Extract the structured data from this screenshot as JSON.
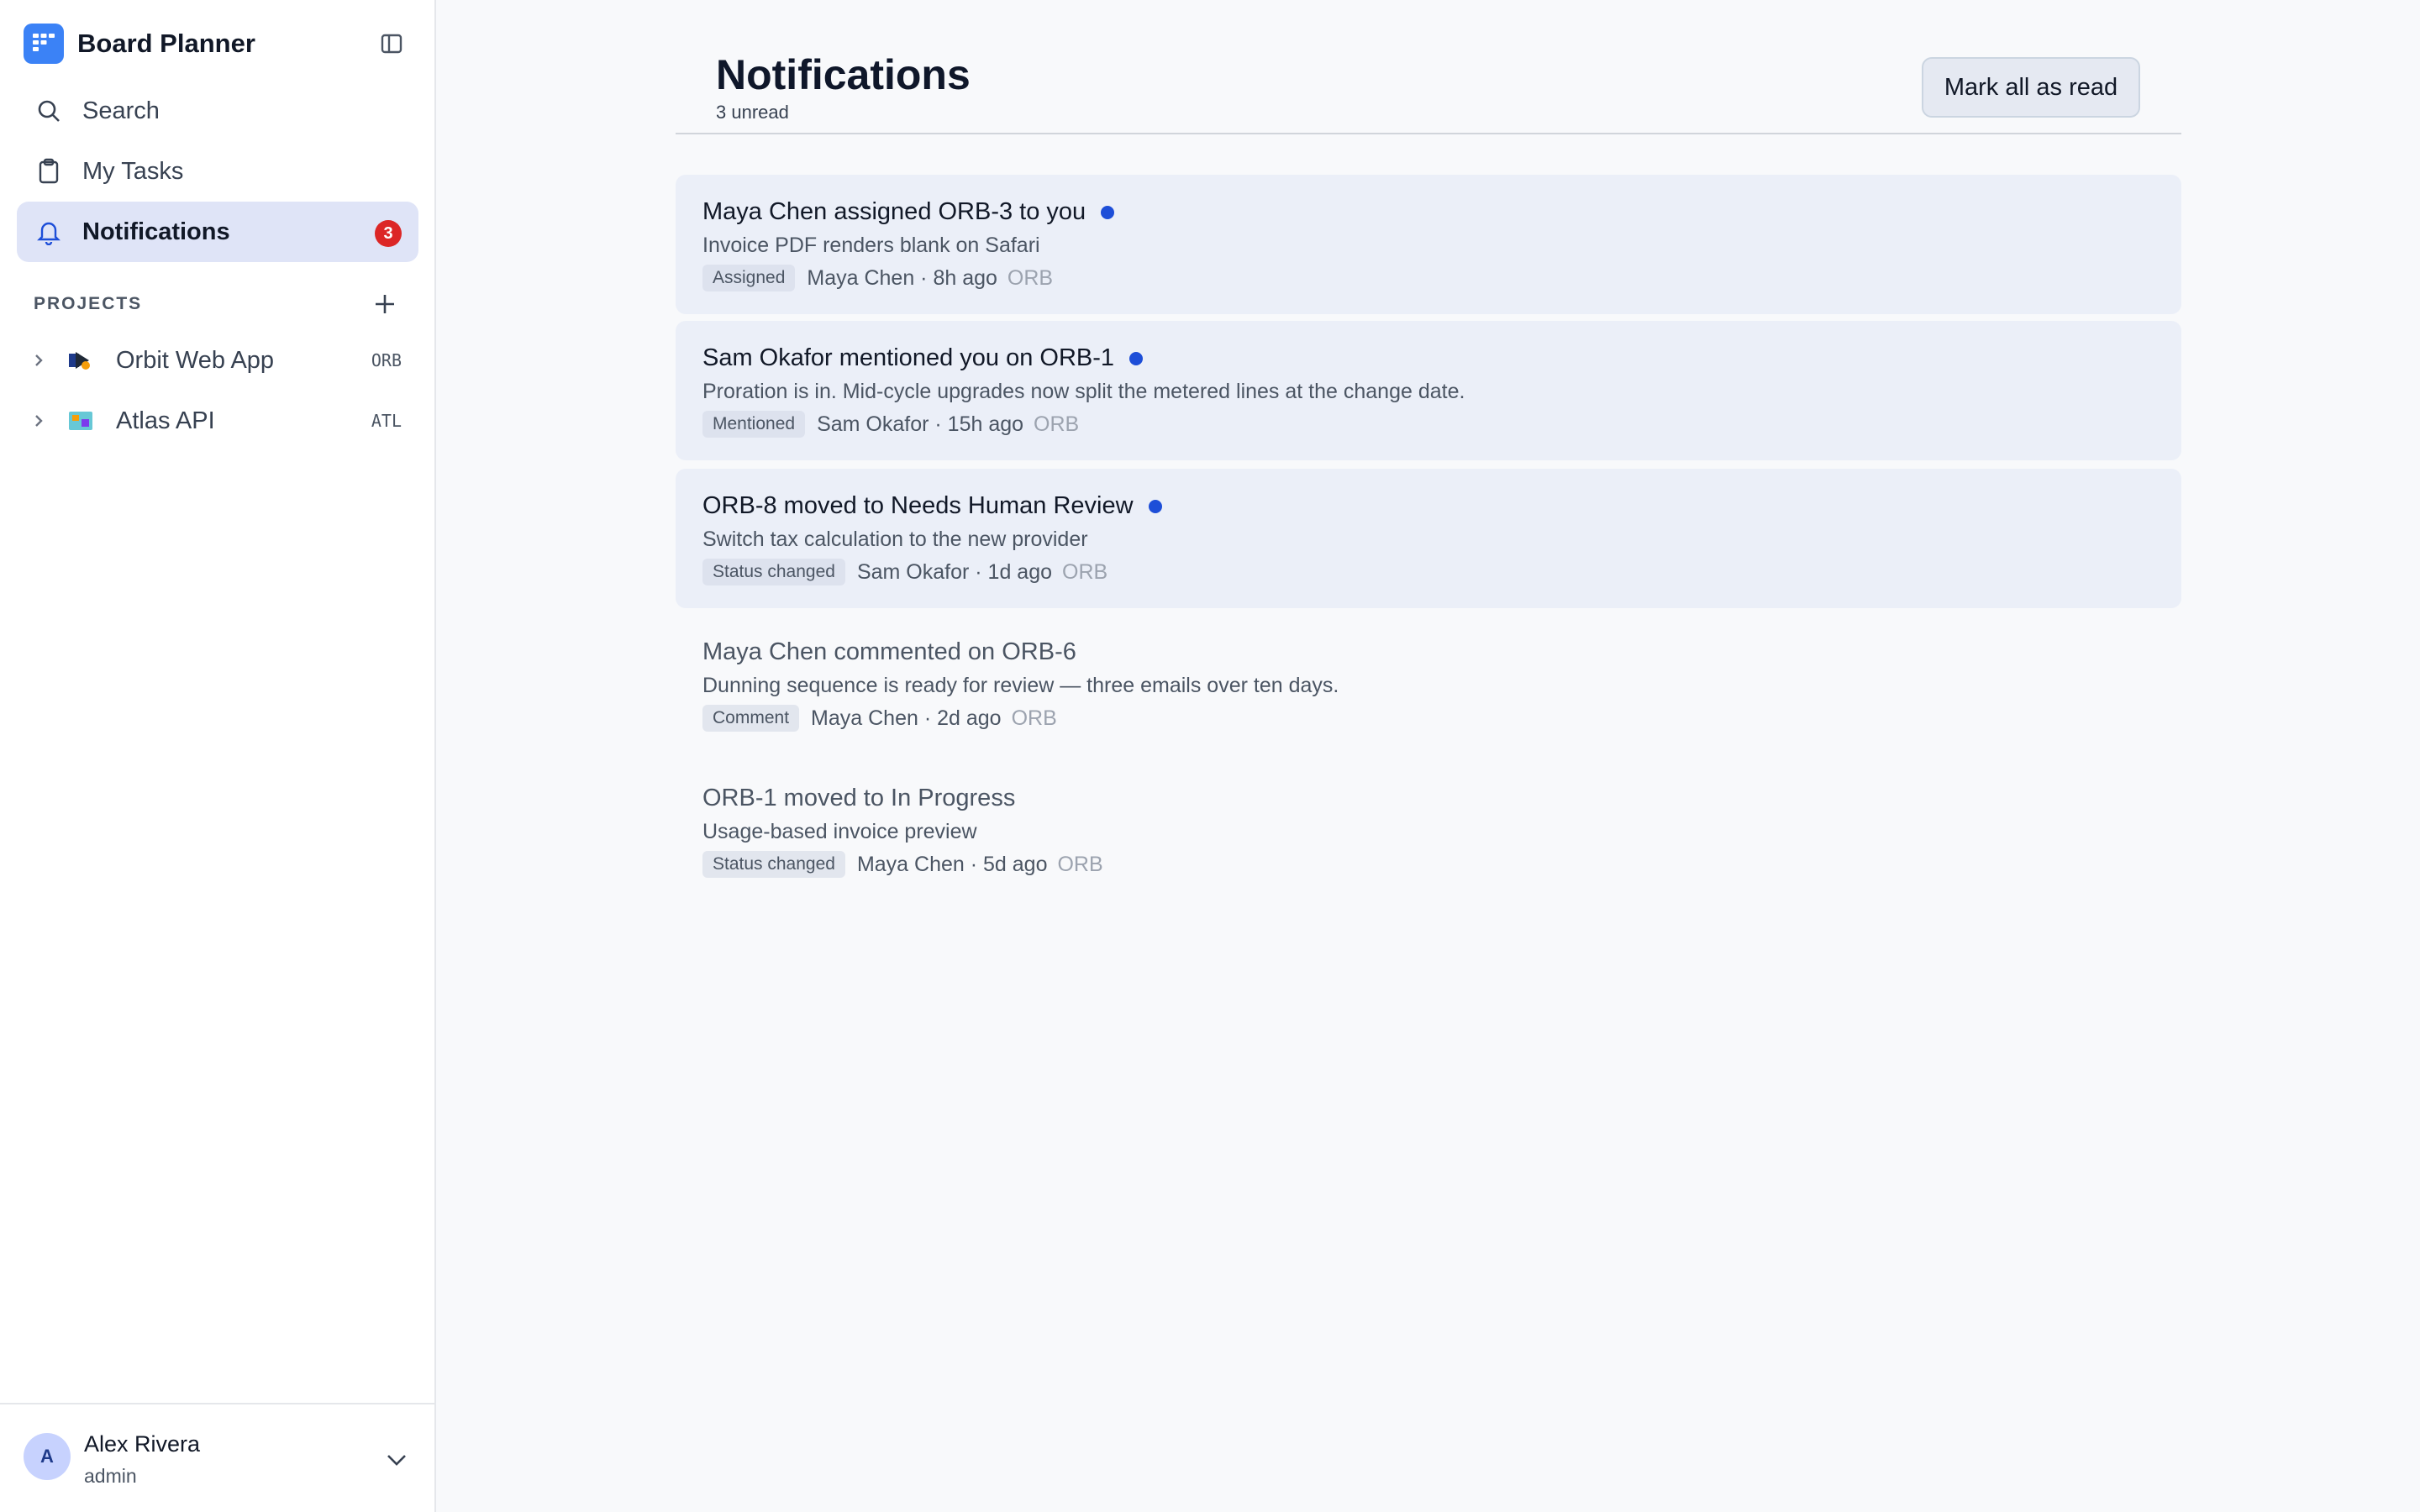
{
  "app": {
    "name": "Board Planner"
  },
  "nav": {
    "search": "Search",
    "my_tasks": "My Tasks",
    "notifications": "Notifications",
    "notifications_badge": "3"
  },
  "projects": {
    "header": "PROJECTS",
    "items": [
      {
        "name": "Orbit Web App",
        "key": "ORB"
      },
      {
        "name": "Atlas API",
        "key": "ATL"
      }
    ]
  },
  "user": {
    "initial": "A",
    "name": "Alex Rivera",
    "role": "admin"
  },
  "page": {
    "title": "Notifications",
    "subtitle": "3 unread",
    "mark_all_label": "Mark all as read"
  },
  "notifications": [
    {
      "title": "Maya Chen assigned ORB-3 to you",
      "body": "Invoice PDF renders blank on Safari",
      "tag": "Assigned",
      "meta": "Maya Chen · 8h ago",
      "project": "ORB",
      "unread": true
    },
    {
      "title": "Sam Okafor mentioned you on ORB-1",
      "body": "Proration is in. Mid-cycle upgrades now split the metered lines at the change date.",
      "tag": "Mentioned",
      "meta": "Sam Okafor · 15h ago",
      "project": "ORB",
      "unread": true
    },
    {
      "title": "ORB-8 moved to Needs Human Review",
      "body": "Switch tax calculation to the new provider",
      "tag": "Status changed",
      "meta": "Sam Okafor · 1d ago",
      "project": "ORB",
      "unread": true
    },
    {
      "title": "Maya Chen commented on ORB-6",
      "body": "Dunning sequence is ready for review — three emails over ten days.",
      "tag": "Comment",
      "meta": "Maya Chen · 2d ago",
      "project": "ORB",
      "unread": false
    },
    {
      "title": "ORB-1 moved to In Progress",
      "body": "Usage-based invoice preview",
      "tag": "Status changed",
      "meta": "Maya Chen · 5d ago",
      "project": "ORB",
      "unread": false
    }
  ],
  "colors": {
    "accent": "#3b82f6",
    "badge": "#dc2626",
    "unread_dot": "#1d4ed8",
    "unread_bg": "#ebeff8"
  }
}
